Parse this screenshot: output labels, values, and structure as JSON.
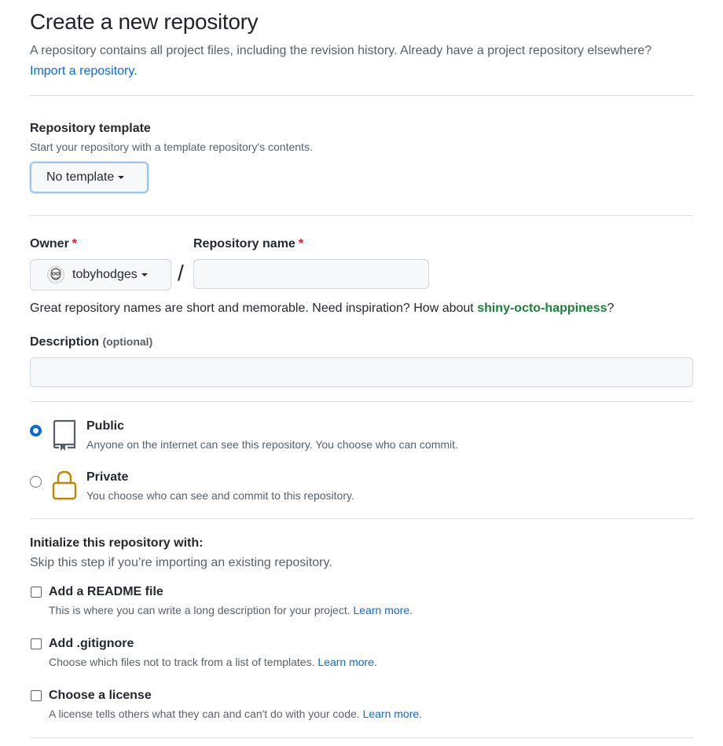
{
  "header": {
    "title": "Create a new repository",
    "subtitle": "A repository contains all project files, including the revision history. Already have a project repository elsewhere?",
    "import_link": "Import a repository."
  },
  "template": {
    "label": "Repository template",
    "note": "Start your repository with a template repository's contents.",
    "button": "No template"
  },
  "owner": {
    "label": "Owner",
    "required": "*",
    "value": "tobyhodges"
  },
  "repo_name": {
    "label": "Repository name",
    "required": "*",
    "value": "",
    "separator": "/"
  },
  "inspiration": {
    "text": "Great repository names are short and memorable. Need inspiration? How about",
    "suggestion": "shiny-octo-happiness",
    "suffix": "?"
  },
  "description": {
    "label": "Description",
    "optional": "(optional)",
    "value": ""
  },
  "visibility": {
    "public": {
      "title": "Public",
      "desc": "Anyone on the internet can see this repository. You choose who can commit.",
      "selected": true
    },
    "private": {
      "title": "Private",
      "desc": "You choose who can see and commit to this repository.",
      "selected": false
    }
  },
  "init": {
    "title": "Initialize this repository with:",
    "note": "Skip this step if you’re importing an existing repository.",
    "options": [
      {
        "title": "Add a README file",
        "desc": "This is where you can write a long description for your project.",
        "link": "Learn more.",
        "checked": false
      },
      {
        "title": "Add .gitignore",
        "desc": "Choose which files not to track from a list of templates.",
        "link": "Learn more.",
        "checked": false
      },
      {
        "title": "Choose a license",
        "desc": "A license tells others what they can and can't do with your code.",
        "link": "Learn more.",
        "checked": false
      }
    ]
  },
  "colors": {
    "link": "#0969da",
    "suggestion": "#1a7f37",
    "required": "#cf222e",
    "lock": "#bf8700"
  }
}
